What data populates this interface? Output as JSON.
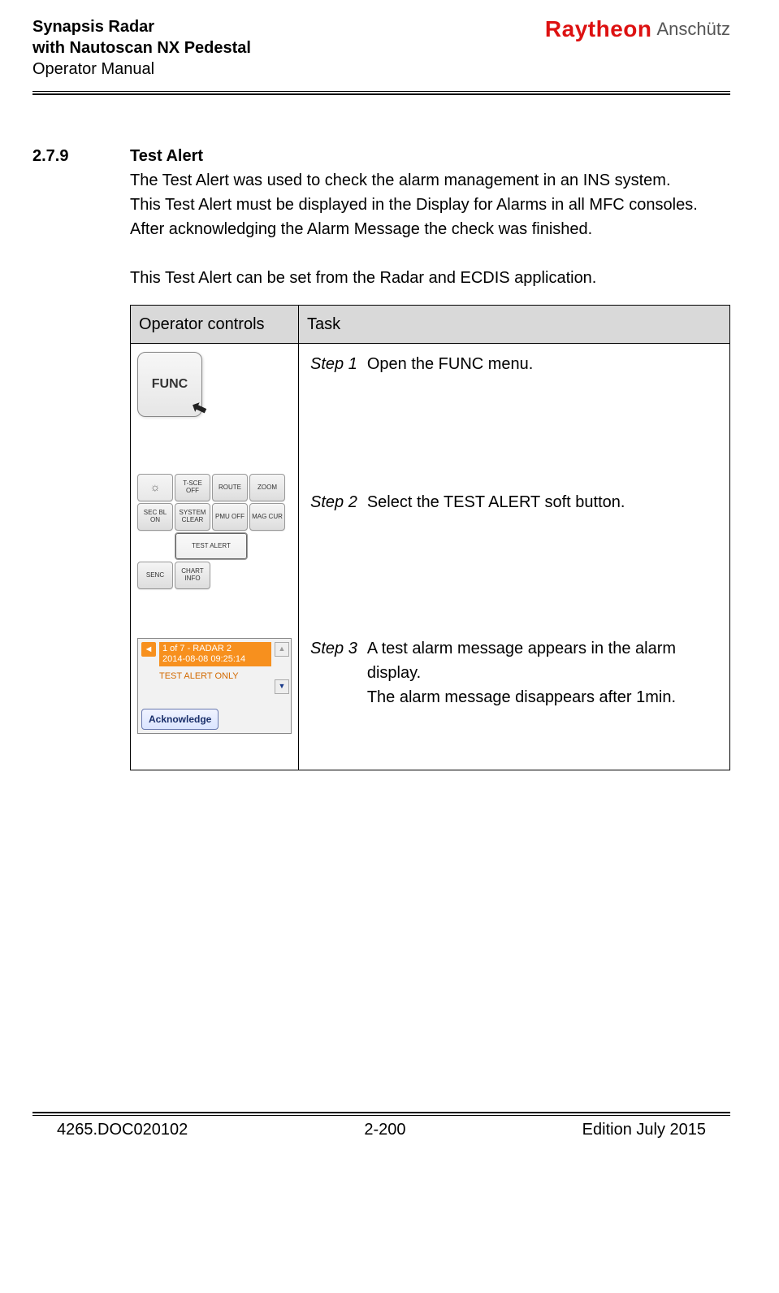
{
  "header": {
    "line1": "Synapsis Radar",
    "line2": "with Nautoscan NX Pedestal",
    "line3": "Operator Manual",
    "brand1": "Raytheon",
    "brand2": "Anschütz"
  },
  "section": {
    "number": "2.7.9",
    "title": "Test Alert",
    "p1": "The Test Alert was used to check the alarm management in an INS system.",
    "p2": "This Test Alert must be displayed in the Display for Alarms in all MFC consoles.",
    "p3": "After acknowledging the Alarm Message the check was finished.",
    "p4": "This Test Alert can be set from the Radar and ECDIS application."
  },
  "table": {
    "th1": "Operator controls",
    "th2": "Task",
    "func_label": "FUNC",
    "softbuttons": {
      "r1c1_icon": "☼",
      "r1c2": "T-SCE OFF",
      "r1c3": "ROUTE",
      "r1c4": "ZOOM",
      "r2c1": "SEC BL ON",
      "r2c2": "SYSTEM CLEAR",
      "r2c3": "PMU OFF",
      "r2c4": "MAG CUR",
      "r3_test": "TEST ALERT",
      "r4c1": "SENC",
      "r4c2": "CHART INFO"
    },
    "alarm": {
      "nav_icon": "◄",
      "header_line1": "1 of 7 - RADAR 2",
      "header_line2": "2014-08-08 09:25:14",
      "message": "TEST ALERT ONLY",
      "up_arrow": "▲",
      "down_arrow": "▼",
      "ack": "Acknowledge"
    },
    "steps": {
      "s1_label": "Step 1",
      "s1_text": "Open the FUNC menu.",
      "s2_label": "Step 2",
      "s2_text": "Select the TEST ALERT soft button.",
      "s3_label": "Step 3",
      "s3_text1": "A test alarm message appears in the alarm display.",
      "s3_text2": "The alarm message disappears after 1min."
    }
  },
  "footer": {
    "left": "4265.DOC020102",
    "center": "2-200",
    "right": "Edition July 2015"
  }
}
